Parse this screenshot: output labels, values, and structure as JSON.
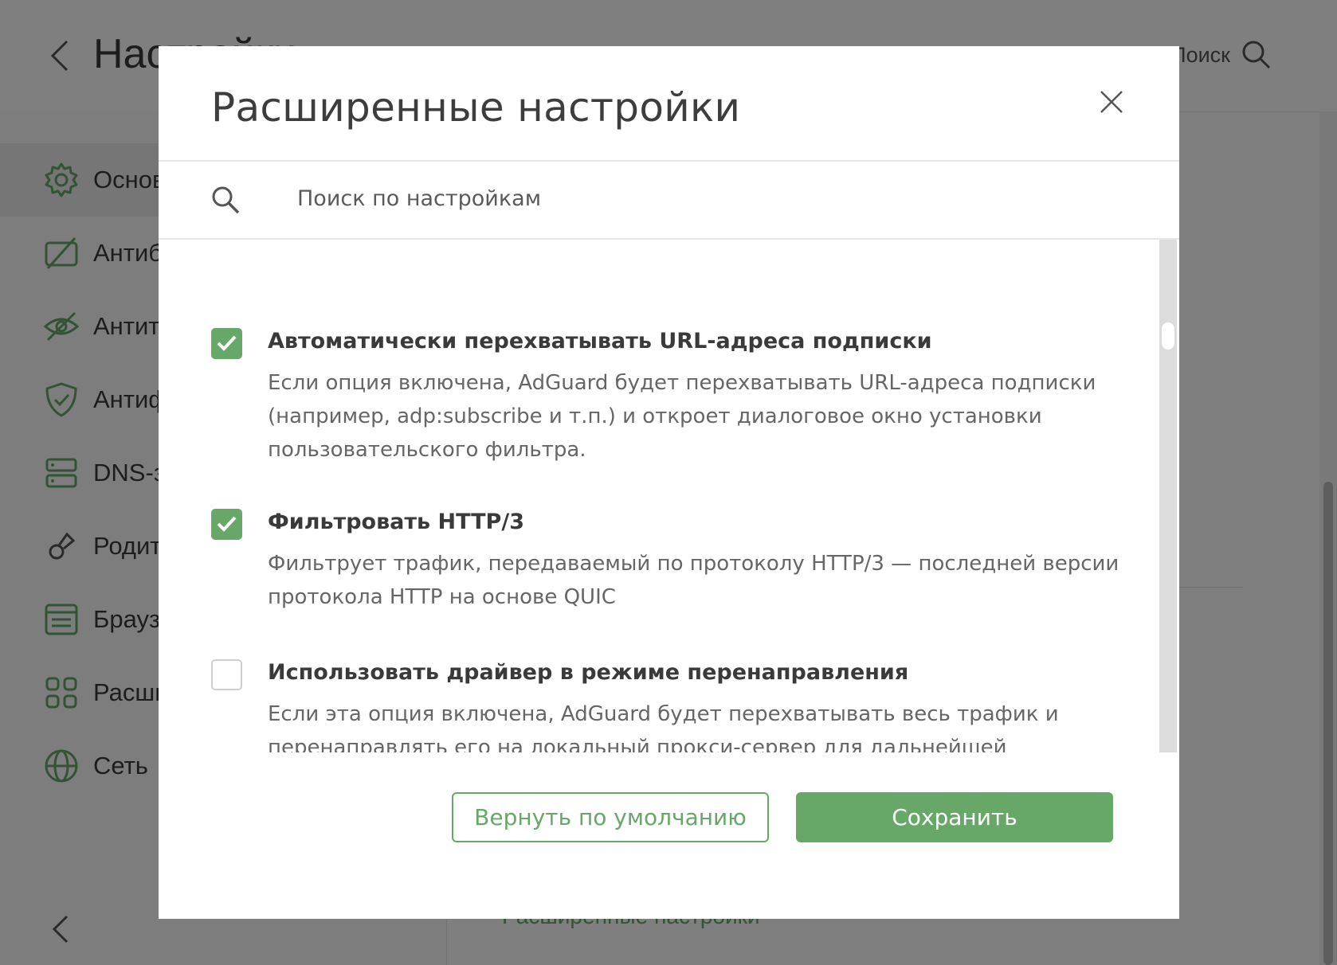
{
  "colors": {
    "accent": "#67a868",
    "text": "#3a3a3a",
    "muted": "#666666",
    "overlay": "rgba(0,0,0,0.5)"
  },
  "app": {
    "title": "Настройки",
    "search_label": "Поиск",
    "sidebar": [
      {
        "label": "Основные настройки",
        "icon": "gear-icon",
        "active": true
      },
      {
        "label": "Антибаннер",
        "icon": "ad-block-icon"
      },
      {
        "label": "Антитрекинг",
        "icon": "eye-crossed-icon"
      },
      {
        "label": "Антифишинг",
        "icon": "shield-check-icon"
      },
      {
        "label": "DNS-защита",
        "icon": "server-icon"
      },
      {
        "label": "Родительский контроль",
        "icon": "kids-icon"
      },
      {
        "label": "Браузерные расширения",
        "icon": "browser-icon"
      },
      {
        "label": "Расширения",
        "icon": "apps-icon"
      },
      {
        "label": "Сеть",
        "icon": "globe-icon"
      }
    ],
    "main_link": "Расширенные настройки"
  },
  "modal": {
    "title": "Расширенные настройки",
    "search": {
      "placeholder": "Поиск по настройкам",
      "value": ""
    },
    "settings": [
      {
        "title": "Автоматически перехватывать URL-адреса подписки",
        "checked": true,
        "description": "Если опция включена, AdGuard будет перехватывать URL-адреса подписки (например, adp:subscribe и т.п.) и откроет диалоговое окно установки пользовательского фильтра."
      },
      {
        "title": "Фильтровать HTTP/3",
        "checked": true,
        "description": "Фильтрует трафик, передаваемый по протоколу HTTP/3 — последней версии протокола HTTP на основе QUIC"
      },
      {
        "title": "Использовать драйвер в режиме перенаправления",
        "checked": false,
        "description": "Если эта опция включена, AdGuard будет перехватывать весь трафик и перенаправлять его на локальный прокси-сервер для дальнейшей фильтрации. Иначе AdGuard будет фильтровать весь трафик на лету, без его"
      }
    ],
    "buttons": {
      "reset": "Вернуть по умолчанию",
      "save": "Сохранить"
    }
  }
}
